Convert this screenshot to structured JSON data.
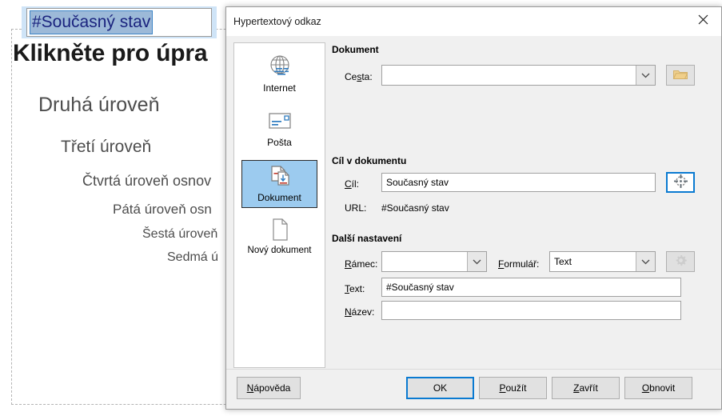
{
  "background": {
    "link_text_box_value": "#Současný stav",
    "outline": {
      "title": "Klikněte pro úpra",
      "levels": [
        "Druhá úroveň",
        "Třetí úroveň",
        "Čtvrtá úroveň osnov",
        "Pátá úroveň osn",
        "Šestá úroveň",
        "Sedmá ú"
      ]
    }
  },
  "dialog": {
    "title": "Hypertextový odkaz",
    "close_label": "×",
    "sidebar": {
      "items": [
        {
          "label": "Internet",
          "icon": "globe-icon",
          "selected": false
        },
        {
          "label": "Pošta",
          "icon": "envelope-icon",
          "selected": false
        },
        {
          "label": "Dokument",
          "icon": "documents-icon",
          "selected": true
        },
        {
          "label": "Nový dokument",
          "icon": "new-document-icon",
          "selected": false
        }
      ]
    },
    "sections": {
      "document": {
        "title": "Dokument",
        "path_label": "Cesta:",
        "path_label_accel": "s",
        "path_value": "",
        "browse_icon": "folder-open-icon"
      },
      "target": {
        "title": "Cíl v dokumentu",
        "target_label": "Cíl:",
        "target_label_accel": "C",
        "target_value": "Současný stav",
        "target_picker_icon": "crosshair-target-icon",
        "url_label": "URL:",
        "url_value": "#Současný stav"
      },
      "further": {
        "title": "Další nastavení",
        "frame_label": "Rámec:",
        "frame_label_accel": "R",
        "frame_value": "",
        "form_label": "Formulář:",
        "form_label_accel": "F",
        "form_value": "Text",
        "form_settings_icon": "gear-icon",
        "text_label": "Text:",
        "text_label_accel": "T",
        "text_value": "#Současný stav",
        "name_label": "Název:",
        "name_label_accel": "N",
        "name_value": ""
      }
    },
    "buttons": {
      "help": "Nápověda",
      "help_accel": "N",
      "ok": "OK",
      "apply": "Použít",
      "apply_accel": "P",
      "close": "Zavřít",
      "close_accel": "Z",
      "reset": "Obnovit",
      "reset_accel": "O"
    }
  },
  "colors": {
    "selection_blue": "#9ccbef",
    "focus_blue": "#0a7ad1",
    "dialog_bg": "#f0f0f0",
    "link_text": "#1a237e"
  }
}
